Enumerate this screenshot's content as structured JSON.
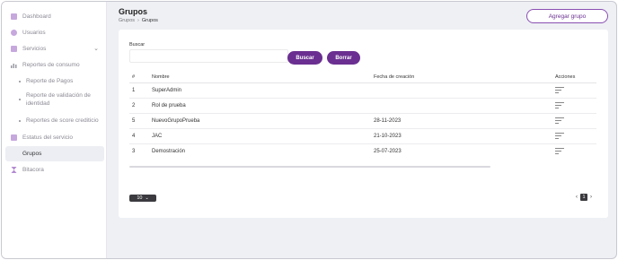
{
  "colors": {
    "accent": "#6a2f91",
    "icon": "#b38bd1"
  },
  "sidebar": {
    "items": [
      {
        "label": "Dashboard",
        "icon": "dashboard-icon"
      },
      {
        "label": "Usuarios",
        "icon": "user-icon"
      },
      {
        "label": "Servicios",
        "icon": "grid-icon"
      },
      {
        "label": "Reportes de consumo",
        "icon": "bar-chart-icon"
      },
      {
        "label": "Reporte de Pagos"
      },
      {
        "label": "Reporte de validación de identidad"
      },
      {
        "label": "Reportes de score crediticio"
      },
      {
        "label": "Estatus del servicio",
        "icon": "monitor-icon"
      },
      {
        "label": "Grupos"
      },
      {
        "label": "Bitacora",
        "icon": "hourglass-icon"
      }
    ]
  },
  "header": {
    "title": "Grupos",
    "breadcrumb": [
      "Grupos",
      "Grupos"
    ],
    "add_button": "Agregar grupo"
  },
  "search": {
    "label": "Buscar",
    "value": "",
    "placeholder": ""
  },
  "buttons": {
    "search": "Buscar",
    "clear": "Borrar"
  },
  "table": {
    "headers": [
      "#",
      "Nombre",
      "Fecha de creación",
      "Acciones"
    ],
    "rows": [
      {
        "id": "1",
        "name": "SuperAdmin",
        "date": ""
      },
      {
        "id": "2",
        "name": "Rol de prueba",
        "date": ""
      },
      {
        "id": "5",
        "name": "NuevoGrupoPrueba",
        "date": "28-11-2023"
      },
      {
        "id": "4",
        "name": "JAC",
        "date": "21-10-2023"
      },
      {
        "id": "3",
        "name": "Demostración",
        "date": "25-07-2023"
      }
    ]
  },
  "pagination": {
    "page_size": "10",
    "current_page": "1"
  }
}
